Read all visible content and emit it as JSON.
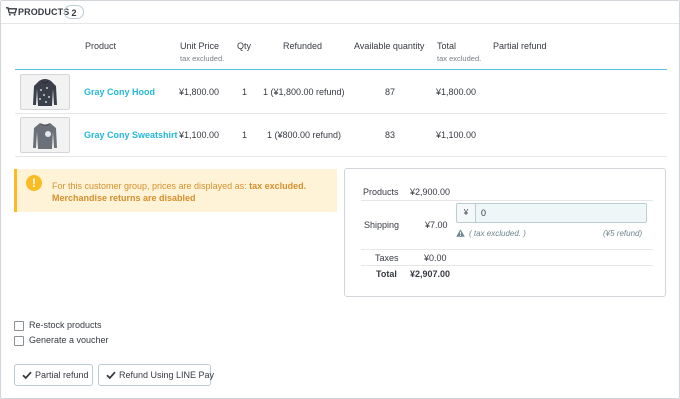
{
  "panel": {
    "title": "PRODUCTS",
    "count": "2",
    "icon": "cart-icon"
  },
  "table": {
    "headers": {
      "product": "Product",
      "unit_price": "Unit Price",
      "unit_price_sub": "tax excluded.",
      "qty": "Qty",
      "refunded": "Refunded",
      "available_quantity": "Available quantity",
      "total": "Total",
      "total_sub": "tax excluded.",
      "partial_refund": "Partial refund"
    },
    "rows": [
      {
        "name": "Gray Cony Hood",
        "unit_price": "¥1,800.00",
        "qty": "1",
        "refunded": "1 (¥1,800.00 refund)",
        "available": "87",
        "total": "¥1,800.00"
      },
      {
        "name": "Gray Cony Sweatshirt",
        "unit_price": "¥1,100.00",
        "qty": "1",
        "refunded": "1 (¥800.00 refund)",
        "available": "83",
        "total": "¥1,100.00"
      }
    ]
  },
  "alert": {
    "prefix": "For this customer group, prices are displayed as: ",
    "emphasis": "tax excluded.",
    "line2": "Merchandise returns are disabled",
    "icon": "warning-icon"
  },
  "summary": {
    "products_label": "Products",
    "products_value": "¥2,900.00",
    "shipping_label": "Shipping",
    "shipping_value": "¥7.00",
    "shipping_currency": "¥",
    "shipping_input": "0",
    "tax_note": "( tax excluded. )",
    "refund_note": "(¥5 refund)",
    "taxes_label": "Taxes",
    "taxes_value": "¥0.00",
    "total_label": "Total",
    "total_value": "¥2,907.00"
  },
  "options": {
    "restock": "Re-stock products",
    "voucher": "Generate a voucher"
  },
  "buttons": {
    "partial_refund": "Partial refund",
    "line_pay": "Refund Using LINE Pay"
  },
  "colors": {
    "link": "#25b9d7",
    "warning_bg": "#fff3d7",
    "warning_text": "#d5902d",
    "header_rule": "#5bc1de"
  }
}
